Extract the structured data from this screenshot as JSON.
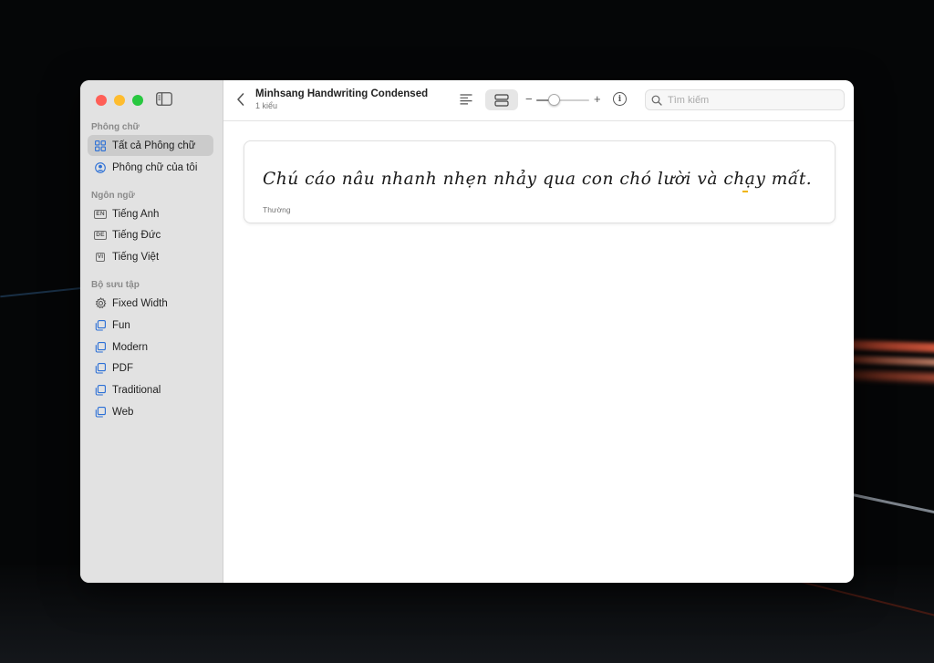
{
  "window": {
    "title": "Minhsang Handwriting Condensed",
    "subtitle": "1 kiểu"
  },
  "sidebar": {
    "sections": [
      {
        "title": "Phông chữ",
        "items": [
          {
            "label": "Tất cả Phông chữ",
            "icon": "grid-icon",
            "selected": true
          },
          {
            "label": "Phông chữ của tôi",
            "icon": "user-circle-icon"
          }
        ]
      },
      {
        "title": "Ngôn ngữ",
        "items": [
          {
            "label": "Tiếng Anh",
            "badge": "EN"
          },
          {
            "label": "Tiếng Đức",
            "badge": "DE"
          },
          {
            "label": "Tiếng Việt",
            "badge": "VI"
          }
        ]
      },
      {
        "title": "Bộ sưu tập",
        "items": [
          {
            "label": "Fixed Width",
            "icon": "gear-icon"
          },
          {
            "label": "Fun",
            "icon": "collection-icon"
          },
          {
            "label": "Modern",
            "icon": "collection-icon"
          },
          {
            "label": "PDF",
            "icon": "collection-icon"
          },
          {
            "label": "Traditional",
            "icon": "collection-icon"
          },
          {
            "label": "Web",
            "icon": "collection-icon"
          }
        ]
      }
    ]
  },
  "toolbar": {
    "minus": "−",
    "plus": "+",
    "info": "i",
    "zoom_level": 0.32,
    "search_placeholder": "Tìm kiếm"
  },
  "preview": {
    "sample_text": "Chú cáo nâu nhanh nhẹn nhảy qua con chó lười và chạy mất.",
    "style_name": "Thường"
  },
  "colors": {
    "traffic_red": "#ff5f57",
    "traffic_yellow": "#febc2e",
    "traffic_green": "#28c840",
    "sidebar_bg": "#e2e2e2",
    "selected_bg": "#cbcbcb",
    "accent_icon": "#2b6fd6",
    "caret": "#f0b400"
  }
}
